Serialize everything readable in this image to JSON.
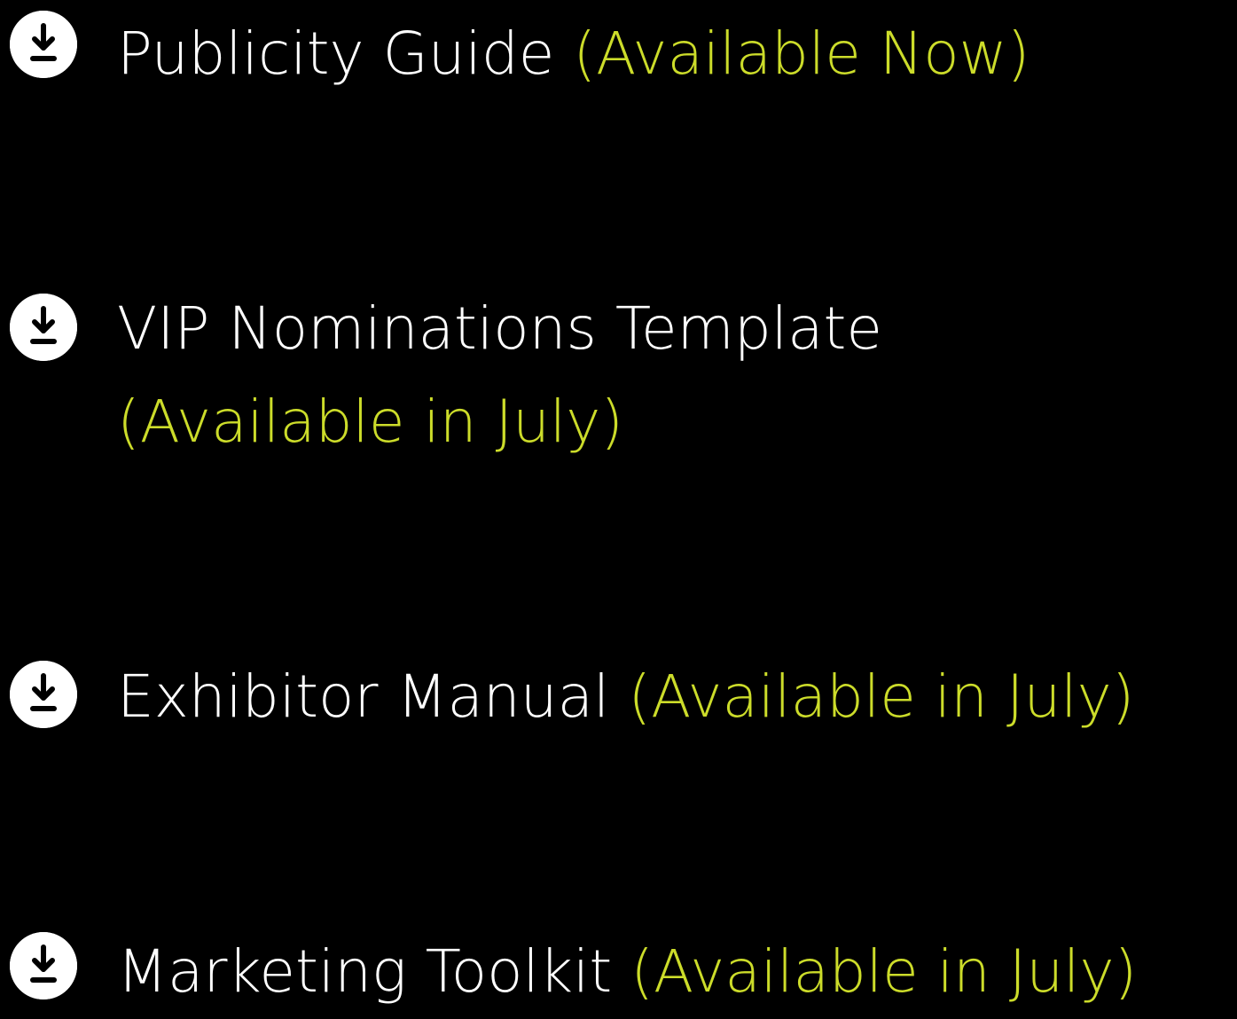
{
  "colors": {
    "background": "#000000",
    "title_text": "#ffffff",
    "status_text": "#ccdc2a",
    "icon_fill": "#ffffff"
  },
  "downloads": [
    {
      "icon": "download-icon",
      "title": "Publicity Guide",
      "status": "(Available Now)"
    },
    {
      "icon": "download-icon",
      "title": "VIP Nominations Template",
      "status": "(Available in July)"
    },
    {
      "icon": "download-icon",
      "title": "Exhibitor Manual",
      "status": "(Available in July)"
    },
    {
      "icon": "download-icon",
      "title": "Marketing Toolkit",
      "status": "(Available in July)"
    }
  ]
}
